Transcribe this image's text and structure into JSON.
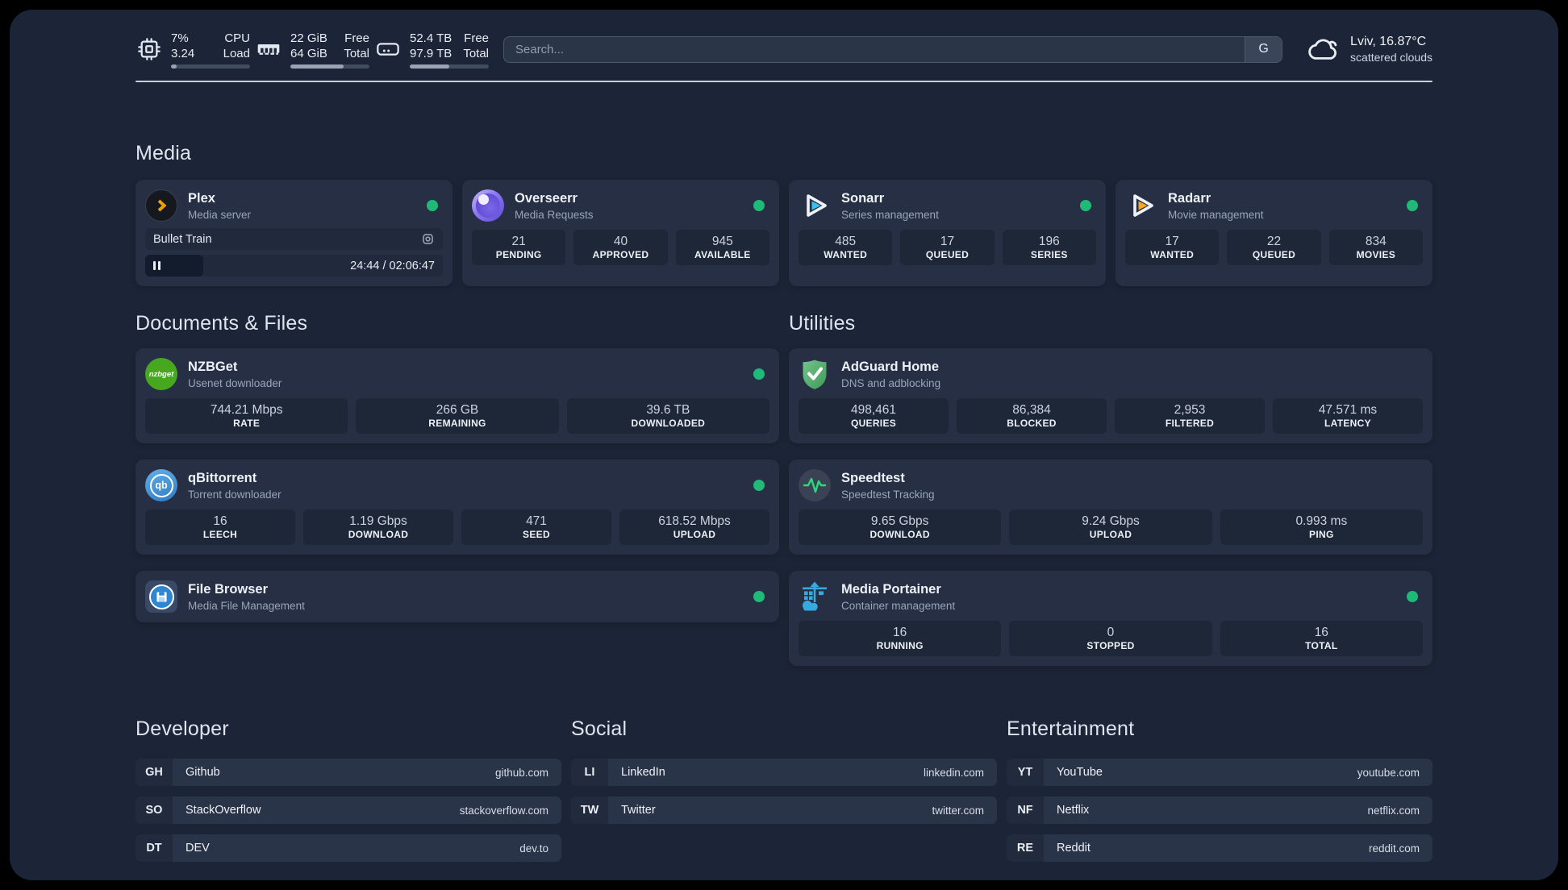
{
  "colors": {
    "board_bg": "#1c2537",
    "card_bg": "#262f44",
    "status_online": "#1fba77",
    "plex_amber": "#e8a00c",
    "sonarr_cyan": "#37c3f1",
    "radarr_amber": "#f7a823",
    "nzbget_green": "#47a71e",
    "qbittorrent_blue": "#3c8fd9",
    "adguard_green": "#5cb470",
    "speedtest_green": "#2bd97e",
    "portainer_blue": "#36a9e1"
  },
  "topbar": {
    "system_widgets": [
      {
        "name": "cpu",
        "value_top": "7%",
        "value_bottom": "3.24",
        "label_top": "CPU",
        "label_bottom": "Load",
        "progress_pct": 7
      },
      {
        "name": "memory",
        "value_top": "22 GiB",
        "value_bottom": "64 GiB",
        "label_top": "Free",
        "label_bottom": "Total",
        "progress_pct": 67
      },
      {
        "name": "storage",
        "value_top": "52.4 TB",
        "value_bottom": "97.9 TB",
        "label_top": "Free",
        "label_bottom": "Total",
        "progress_pct": 50
      }
    ],
    "search": {
      "placeholder": "Search...",
      "provider_button": "G"
    },
    "weather": {
      "location_temp": "Lviv, 16.87°C",
      "condition": "scattered clouds"
    }
  },
  "sections": {
    "media": {
      "title": "Media",
      "plex": {
        "name": "Plex",
        "description": "Media server",
        "online": true,
        "now_playing": {
          "title": "Bullet Train",
          "time": "24:44 / 02:06:47",
          "progress_pct": 19.5,
          "state": "paused"
        }
      },
      "overseerr": {
        "name": "Overseerr",
        "description": "Media Requests",
        "online": true,
        "stats": [
          {
            "value": "21",
            "label": "PENDING"
          },
          {
            "value": "40",
            "label": "APPROVED"
          },
          {
            "value": "945",
            "label": "AVAILABLE"
          }
        ]
      },
      "sonarr": {
        "name": "Sonarr",
        "description": "Series management",
        "online": true,
        "stats": [
          {
            "value": "485",
            "label": "WANTED"
          },
          {
            "value": "17",
            "label": "QUEUED"
          },
          {
            "value": "196",
            "label": "SERIES"
          }
        ]
      },
      "radarr": {
        "name": "Radarr",
        "description": "Movie management",
        "online": true,
        "stats": [
          {
            "value": "17",
            "label": "WANTED"
          },
          {
            "value": "22",
            "label": "QUEUED"
          },
          {
            "value": "834",
            "label": "MOVIES"
          }
        ]
      }
    },
    "documents": {
      "title": "Documents & Files",
      "nzbget": {
        "name": "NZBGet",
        "description": "Usenet downloader",
        "online": true,
        "icon_text": "nzbget",
        "stats": [
          {
            "value": "744.21 Mbps",
            "label": "RATE"
          },
          {
            "value": "266 GB",
            "label": "REMAINING"
          },
          {
            "value": "39.6 TB",
            "label": "DOWNLOADED"
          }
        ]
      },
      "qbittorrent": {
        "name": "qBittorrent",
        "description": "Torrent downloader",
        "online": true,
        "icon_text": "qb",
        "stats": [
          {
            "value": "16",
            "label": "LEECH"
          },
          {
            "value": "1.19 Gbps",
            "label": "DOWNLOAD"
          },
          {
            "value": "471",
            "label": "SEED"
          },
          {
            "value": "618.52 Mbps",
            "label": "UPLOAD"
          }
        ]
      },
      "filebrowser": {
        "name": "File Browser",
        "description": "Media File Management",
        "online": true
      }
    },
    "utilities": {
      "title": "Utilities",
      "adguard": {
        "name": "AdGuard Home",
        "description": "DNS and adblocking",
        "stats": [
          {
            "value": "498,461",
            "label": "QUERIES"
          },
          {
            "value": "86,384",
            "label": "BLOCKED"
          },
          {
            "value": "2,953",
            "label": "FILTERED"
          },
          {
            "value": "47.571 ms",
            "label": "LATENCY"
          }
        ]
      },
      "speedtest": {
        "name": "Speedtest",
        "description": "Speedtest Tracking",
        "stats": [
          {
            "value": "9.65 Gbps",
            "label": "DOWNLOAD"
          },
          {
            "value": "9.24 Gbps",
            "label": "UPLOAD"
          },
          {
            "value": "0.993 ms",
            "label": "PING"
          }
        ]
      },
      "portainer": {
        "name": "Media Portainer",
        "description": "Container management",
        "online": true,
        "stats": [
          {
            "value": "16",
            "label": "RUNNING"
          },
          {
            "value": "0",
            "label": "STOPPED"
          },
          {
            "value": "16",
            "label": "TOTAL"
          }
        ]
      }
    },
    "bookmarks": [
      {
        "title": "Developer",
        "items": [
          {
            "abbr": "GH",
            "name": "Github",
            "url": "github.com"
          },
          {
            "abbr": "SO",
            "name": "StackOverflow",
            "url": "stackoverflow.com"
          },
          {
            "abbr": "DT",
            "name": "DEV",
            "url": "dev.to"
          }
        ]
      },
      {
        "title": "Social",
        "items": [
          {
            "abbr": "LI",
            "name": "LinkedIn",
            "url": "linkedin.com"
          },
          {
            "abbr": "TW",
            "name": "Twitter",
            "url": "twitter.com"
          }
        ]
      },
      {
        "title": "Entertainment",
        "items": [
          {
            "abbr": "YT",
            "name": "YouTube",
            "url": "youtube.com"
          },
          {
            "abbr": "NF",
            "name": "Netflix",
            "url": "netflix.com"
          },
          {
            "abbr": "RE",
            "name": "Reddit",
            "url": "reddit.com"
          }
        ]
      }
    ]
  }
}
